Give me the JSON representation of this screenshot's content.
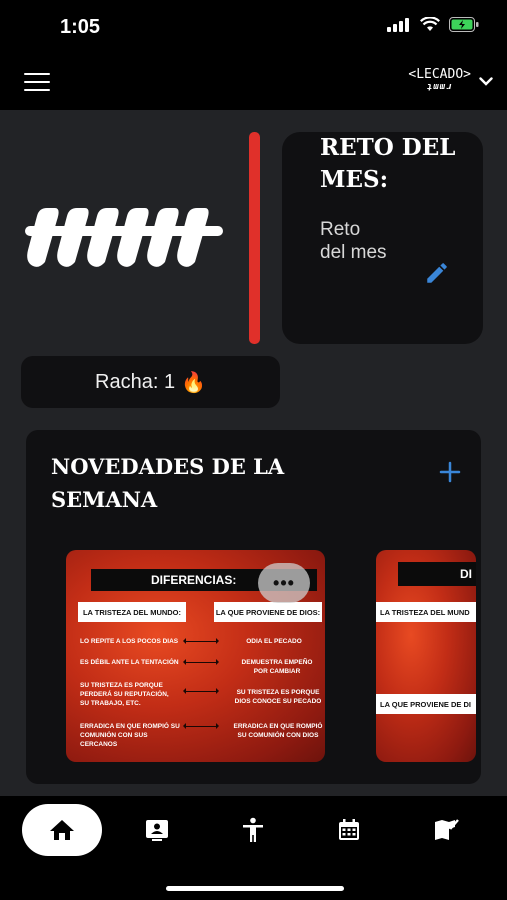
{
  "status_bar": {
    "time": "1:05"
  },
  "header": {
    "brand": "LECADO",
    "brand_sub": "ʇɯɯɹ"
  },
  "reto": {
    "title": "RETO DEL\nMES:",
    "text": "Reto\ndel mes"
  },
  "racha": {
    "label": "Racha: 1",
    "emoji": "🔥"
  },
  "novedades": {
    "title": "NOVEDADES DE LA SEMANA",
    "slides": [
      {
        "header": "DIFERENCIAS:",
        "left_title": "LA TRISTEZA DEL MUNDO:",
        "right_title": "LA QUE PROVIENE DE DIOS:",
        "rows": [
          {
            "left": "LO REPITE A LOS POCOS DIAS",
            "right": "ODIA EL PECADO"
          },
          {
            "left": "ES DÉBIL ANTE LA TENTACIÓN",
            "right": "DEMUESTRA EMPEÑO POR CAMBIAR"
          },
          {
            "left": "SU TRISTEZA ES PORQUE PERDERÁ SU REPUTACIÓN, SU TRABAJO, ETC.",
            "right": "SU TRISTEZA ES PORQUE DIOS CONOCE SU PECADO"
          },
          {
            "left": "ERRADICA EN QUE ROMPIÓ SU COMUNIÓN CON SUS CERCANOS",
            "right": "ERRADICA EN QUE ROMPIÓ SU COMUNIÓN CON DIOS"
          }
        ]
      },
      {
        "header": "DI",
        "box1": "LA TRISTEZA DEL MUND",
        "box2": "LA QUE PROVIENE DE DI"
      }
    ],
    "more_label": "•••"
  },
  "nav": {
    "items": [
      "home-icon",
      "contact-card-icon",
      "accessibility-icon",
      "calendar-icon",
      "map-check-icon"
    ]
  },
  "colors": {
    "accent_red": "#e0302a",
    "accent_blue": "#3a86d8",
    "card_bg": "#101012",
    "page_bg": "#222326"
  }
}
